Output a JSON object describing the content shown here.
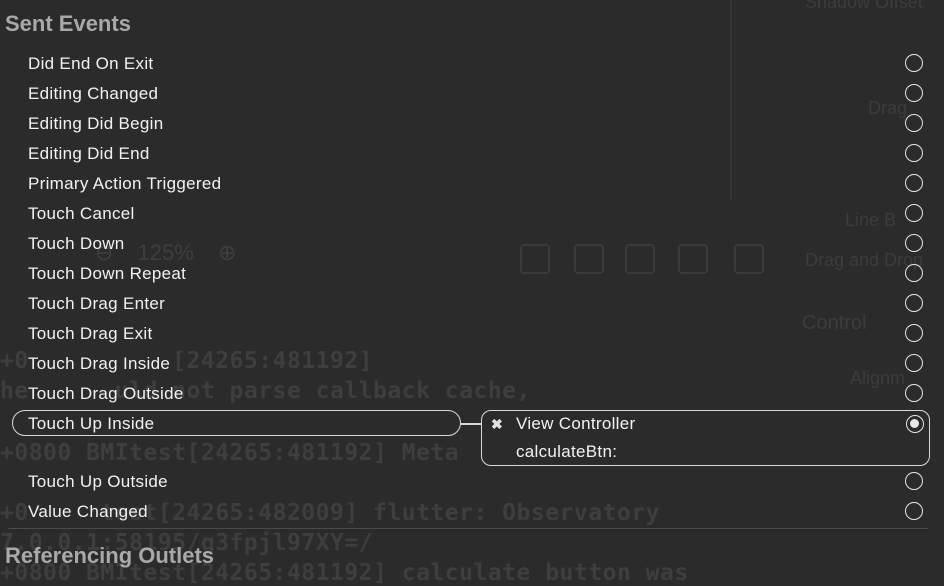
{
  "background": {
    "code_lines": [
      "+0          [24265:481192]",
      "he      uld not parse callback cache,",
      "+0800 BMItest[24265:481192] Meta",
      "+0     test[24265:482009] flutter: Observatory",
      "7.0.0.1:58195/g3fpjl97XY=/",
      "+0800 BMItest[24265:481192] calculate button was"
    ],
    "zoom": "125%",
    "inspector_labels": [
      "Shadow Offset",
      "Drag",
      "Line B",
      "Drag and Drop",
      "Control",
      "Alignm"
    ]
  },
  "sent_events": {
    "title": "Sent Events",
    "events": [
      {
        "label": "Did End On Exit"
      },
      {
        "label": "Editing Changed"
      },
      {
        "label": "Editing Did Begin"
      },
      {
        "label": "Editing Did End"
      },
      {
        "label": "Primary Action Triggered"
      },
      {
        "label": "Touch Cancel"
      },
      {
        "label": "Touch Down"
      },
      {
        "label": "Touch Down Repeat"
      },
      {
        "label": "Touch Drag Enter"
      },
      {
        "label": "Touch Drag Exit"
      },
      {
        "label": "Touch Drag Inside"
      },
      {
        "label": "Touch Drag Outside"
      },
      {
        "label": "Touch Up Inside"
      },
      {
        "label": "Touch Up Outside"
      },
      {
        "label": "Value Changed"
      }
    ],
    "connection": {
      "event": "Touch Up Inside",
      "target": "View Controller",
      "method": "calculateBtn:",
      "remove_icon": "close-x-icon"
    }
  },
  "referencing_outlets": {
    "title": "Referencing Outlets"
  },
  "colors": {
    "background": "#2b2b2b",
    "text": "#f2f2f2",
    "section_title": "#a9a9a9",
    "outline": "#d9d9d9"
  }
}
